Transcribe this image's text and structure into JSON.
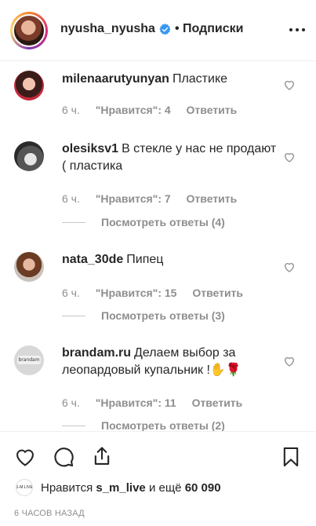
{
  "header": {
    "username": "nyusha_nyusha",
    "follow_label": "• Подписки",
    "verified_icon": "verified-badge-icon",
    "more_icon": "more-options-icon"
  },
  "comments": [
    {
      "username": "milenaarutyunyan",
      "text": "Пластике",
      "time": "6 ч.",
      "likes": "\"Нравится\": 4",
      "reply": "Ответить",
      "view_replies": ""
    },
    {
      "username": "olesiksv1",
      "text": "В стекле у нас не продают ( пластика",
      "time": "6 ч.",
      "likes": "\"Нравится\": 7",
      "reply": "Ответить",
      "view_replies": "Посмотреть ответы (4)"
    },
    {
      "username": "nata_30de",
      "text": "Пипец",
      "time": "6 ч.",
      "likes": "\"Нравится\": 15",
      "reply": "Ответить",
      "view_replies": "Посмотреть ответы (3)"
    },
    {
      "username": "brandam.ru",
      "text": "Делаем выбор за леопардовый купальник !✋🌹",
      "time": "6 ч.",
      "likes": "\"Нравится\": 11",
      "reply": "Ответить",
      "view_replies": "Посмотреть ответы (2)"
    }
  ],
  "footer": {
    "likes_prefix": "Нравится",
    "likes_user": "s_m_live",
    "likes_middle": "и ещё",
    "likes_count": "60 090",
    "timestamp": "6 ЧАСОВ НАЗАД",
    "liker_avatar_text": "S·M·LIVE"
  },
  "icons": {
    "like": "heart-icon",
    "comment": "comment-icon",
    "share": "share-icon",
    "save": "bookmark-icon",
    "comment_like": "heart-outline-icon"
  },
  "colors": {
    "text": "#262626",
    "secondary": "#8e8e8e",
    "verified": "#3897f0",
    "border": "#efefef"
  }
}
